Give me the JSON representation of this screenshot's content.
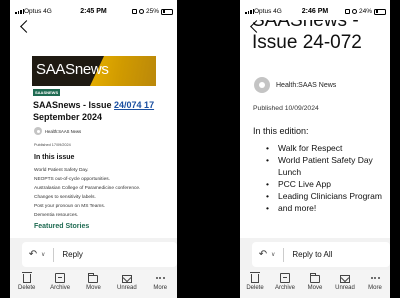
{
  "left": {
    "status": {
      "carrier": "Optus 4G",
      "time": "2:45 PM",
      "battery": "25%",
      "battery_level": 0.25
    },
    "banner_logo": "SAASnews",
    "badge": "SAASNEWS",
    "title_prefix": "SAASnews - Issue ",
    "title_link": "24/074 17",
    "title_suffix": " September 2024",
    "author": "Health:SAAS News",
    "published": "Published 17/09/2024",
    "in_this_issue": "In this issue",
    "items": [
      "World Patient Safety Day.",
      "NEOPTS out-of-cycle opportunities.",
      "Australasian College of Paramedicine conference.",
      "Changes to sensitivity labels.",
      "Post your pronoun on MS Teams.",
      "Dementia resources."
    ],
    "featured": "Featured Stories",
    "reply_label": "Reply"
  },
  "right": {
    "status": {
      "carrier": "Optus 4G",
      "time": "2:46 PM",
      "battery": "24%",
      "battery_level": 0.24
    },
    "title_cut": "SAASnews -",
    "title_line": "Issue 24-072",
    "author": "Health:SAAS News",
    "published": "Published 10/09/2024",
    "in_this_edition": "In this edition:",
    "items": [
      "Walk for Respect",
      "World Patient Safety Day Lunch",
      "PCC Live App",
      "Leading Clinicians Program",
      "and more!"
    ],
    "reply_label": "Reply to All"
  },
  "toolbar": [
    {
      "label": "Delete",
      "icon": "trash-icon"
    },
    {
      "label": "Archive",
      "icon": "archive-icon"
    },
    {
      "label": "Move",
      "icon": "folder-icon"
    },
    {
      "label": "Unread",
      "icon": "mail-icon"
    },
    {
      "label": "More",
      "icon": "more-icon"
    }
  ]
}
